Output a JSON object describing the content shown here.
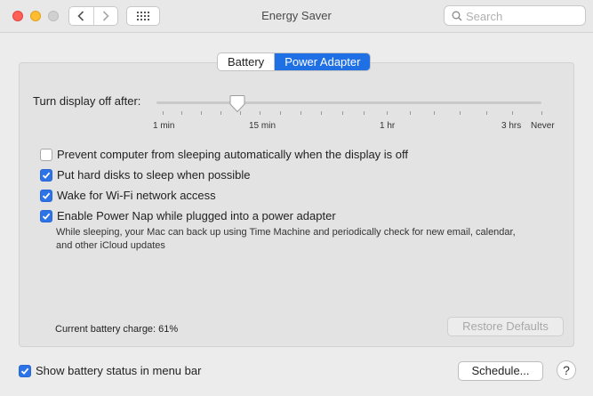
{
  "window": {
    "title": "Energy Saver"
  },
  "search": {
    "placeholder": "Search"
  },
  "tabs": [
    {
      "label": "Battery",
      "selected": false
    },
    {
      "label": "Power Adapter",
      "selected": true
    }
  ],
  "display_slider": {
    "label": "Turn display off after:",
    "tick_labels": [
      "1 min",
      "15 min",
      "1 hr",
      "3 hrs",
      "Never"
    ],
    "value": "15 min"
  },
  "options": [
    {
      "label": "Prevent computer from sleeping automatically when the display is off",
      "checked": false
    },
    {
      "label": "Put hard disks to sleep when possible",
      "checked": true
    },
    {
      "label": "Wake for Wi-Fi network access",
      "checked": true
    },
    {
      "label": "Enable Power Nap while plugged into a power adapter",
      "checked": true
    }
  ],
  "power_nap_description": "While sleeping, your Mac can back up using Time Machine and periodically check for new email, calendar, and other iCloud updates",
  "battery_charge_text": "Current battery charge: 61%",
  "restore_defaults_label": "Restore Defaults",
  "show_battery_status": {
    "label": "Show battery status in menu bar",
    "checked": true
  },
  "schedule_label": "Schedule...",
  "help_label": "?",
  "colors": {
    "accent": "#1f6fe5",
    "checkbox": "#2d73e8"
  }
}
